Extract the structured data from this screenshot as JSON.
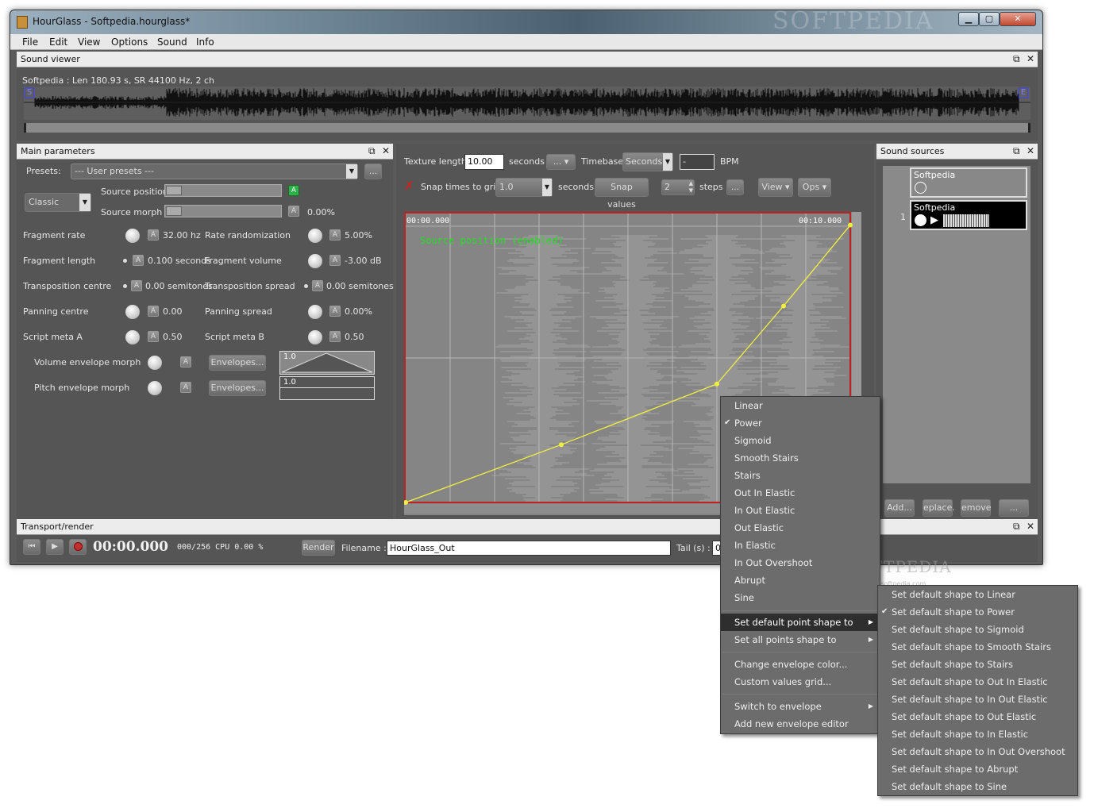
{
  "window": {
    "title": "HourGlass - Softpedia.hourglass*",
    "watermark": "SOFTPEDIA",
    "minimize": "▁",
    "maximize": "▢",
    "close": "✕"
  },
  "menubar": [
    "File",
    "Edit",
    "View",
    "Options",
    "Sound",
    "Info"
  ],
  "sound_viewer": {
    "title": "Sound viewer",
    "info": "Softpedia : Len 180.93 s, SR 44100 Hz, 2 ch",
    "start_marker": "S",
    "end_marker": "E"
  },
  "main_params": {
    "title": "Main parameters",
    "presets_label": "Presets:",
    "presets_value": "--- User presets ---",
    "presets_more": "...",
    "mode_value": "Classic",
    "source_position_label": "Source position",
    "source_position_auto": "A",
    "source_morph_label": "Source morph",
    "source_morph_auto": "A",
    "source_morph_value": "0.00%",
    "rows": [
      {
        "l1": "Fragment rate",
        "v1": "32.00 hz",
        "l2": "Rate randomization",
        "v2": "5.00%"
      },
      {
        "l1": "Fragment length",
        "v1": "0.100 seconds",
        "l2": "Fragment volume",
        "v2": "-3.00 dB"
      },
      {
        "l1": "Transposition centre",
        "v1": "0.00 semitones",
        "l2": "Transposition spread",
        "v2": "0.00 semitones"
      },
      {
        "l1": "Panning centre",
        "v1": "0.00",
        "l2": "Panning spread",
        "v2": "0.00%"
      },
      {
        "l1": "Script meta A",
        "v1": "0.50",
        "l2": "Script meta B",
        "v2": "0.50"
      }
    ],
    "auto_label": "A",
    "volume_env_label": "Volume envelope morph",
    "pitch_env_label": "Pitch envelope morph",
    "envelopes_btn": "Envelopes...",
    "env_val1": "1.0",
    "env_val2": "1.0"
  },
  "envelope_editor": {
    "texture_length_label": "Texture length",
    "texture_length_value": "10.00",
    "seconds_label": "seconds",
    "dropdown_more": "...",
    "timebase_label": "Timebase",
    "timebase_value": "Seconds",
    "bpm_value": "-",
    "bpm_label": "BPM",
    "snap_label": "Snap times to grid",
    "snap_value": "1.0",
    "snap_seconds": "seconds",
    "snap_values_btn": "Snap values",
    "steps_value": "2",
    "steps_label": "steps",
    "steps_more": "...",
    "view_btn": "View",
    "ops_btn": "Ops",
    "time_start": "00:00.000",
    "time_end": "00:10.000",
    "envelope_name": "Source position (enabled)",
    "points": [
      [
        0.0,
        0.0
      ],
      [
        0.35,
        0.2
      ],
      [
        0.7,
        0.41
      ],
      [
        0.85,
        0.68
      ],
      [
        1.0,
        0.96
      ]
    ]
  },
  "sound_sources": {
    "title": "Sound sources",
    "items": [
      {
        "name": "Softpedia",
        "index": ""
      },
      {
        "name": "Softpedia",
        "index": "1"
      }
    ],
    "buttons": [
      "Add...",
      "eplace.",
      "emove",
      "..."
    ]
  },
  "transport": {
    "title": "Transport/render",
    "time": "00:00.000",
    "status": "000/256 CPU 0.00 %",
    "render_btn": "Render",
    "filename_label": "Filename :",
    "filename_value": "HourGlass_Out",
    "tail_label": "Tail (s) :",
    "tail_value": "0"
  },
  "context_menu": {
    "items": [
      {
        "label": "Linear",
        "checked": false
      },
      {
        "label": "Power",
        "checked": true
      },
      {
        "label": "Sigmoid",
        "checked": false
      },
      {
        "label": "Smooth Stairs",
        "checked": false
      },
      {
        "label": "Stairs",
        "checked": false
      },
      {
        "label": "Out In Elastic",
        "checked": false
      },
      {
        "label": "In Out Elastic",
        "checked": false
      },
      {
        "label": "Out Elastic",
        "checked": false
      },
      {
        "label": "In Elastic",
        "checked": false
      },
      {
        "label": "In Out Overshoot",
        "checked": false
      },
      {
        "label": "Abrupt",
        "checked": false
      },
      {
        "label": "Sine",
        "checked": false
      }
    ],
    "default_shape": "Set default point shape to",
    "all_shape": "Set all points shape to",
    "change_color": "Change envelope color...",
    "custom_grid": "Custom values grid...",
    "switch_env": "Switch to envelope",
    "add_editor": "Add new envelope editor"
  },
  "submenu": {
    "items": [
      {
        "label": "Set default shape to Linear",
        "checked": false
      },
      {
        "label": "Set default shape to Power",
        "checked": true
      },
      {
        "label": "Set default shape to Sigmoid",
        "checked": false
      },
      {
        "label": "Set default shape to Smooth Stairs",
        "checked": false
      },
      {
        "label": "Set default shape to Stairs",
        "checked": false
      },
      {
        "label": "Set default shape to Out In Elastic",
        "checked": false
      },
      {
        "label": "Set default shape to In Out Elastic",
        "checked": false
      },
      {
        "label": "Set default shape to Out Elastic",
        "checked": false
      },
      {
        "label": "Set default shape to In Elastic",
        "checked": false
      },
      {
        "label": "Set default shape to In Out Overshoot",
        "checked": false
      },
      {
        "label": "Set default shape to Abrupt",
        "checked": false
      },
      {
        "label": "Set default shape to Sine",
        "checked": false
      }
    ]
  },
  "overlay_watermark": "SOFTPEDIA",
  "overlay_url": "www.softpedia.com",
  "colors": {
    "envelope": "#f0f040",
    "border_red": "#c02020",
    "label_green": "#20e020"
  }
}
